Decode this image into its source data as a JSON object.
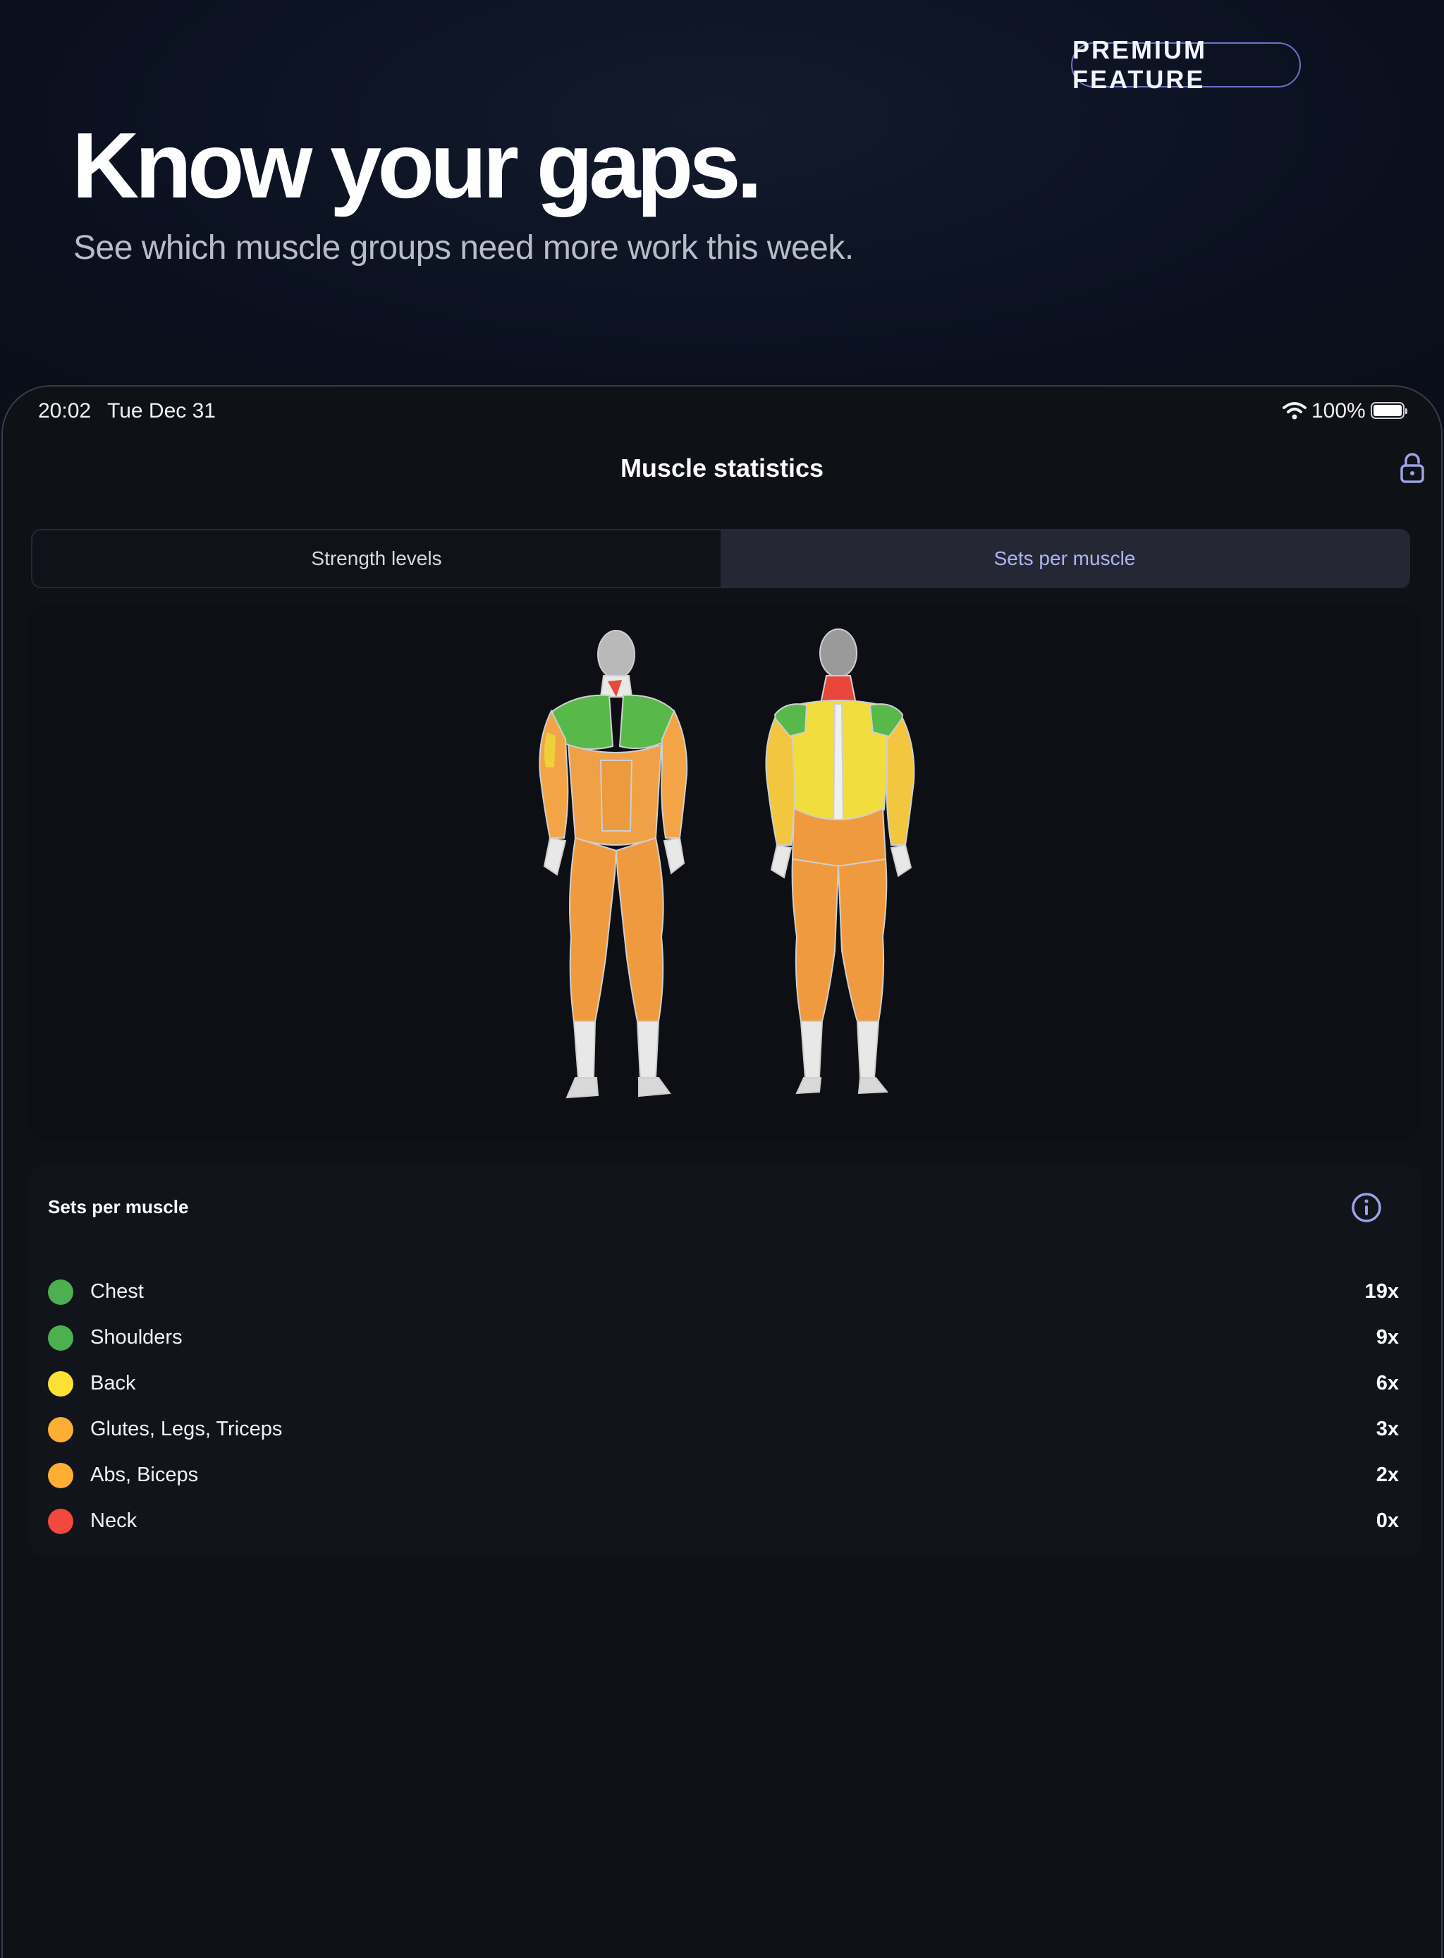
{
  "hero": {
    "badge": "PREMIUM FEATURE",
    "title": "Know your gaps.",
    "subtitle": "See which muscle groups need more work this week."
  },
  "status_bar": {
    "time": "20:02",
    "date": "Tue Dec 31",
    "battery": "100%",
    "icons": [
      "wifi-icon",
      "battery-icon"
    ]
  },
  "nav": {
    "title": "Muscle statistics",
    "right_icon": "lock-open-icon"
  },
  "tabs": [
    {
      "label": "Strength levels",
      "active": false
    },
    {
      "label": "Sets per muscle",
      "active": true
    }
  ],
  "body_map": {
    "views": [
      "front",
      "back"
    ],
    "icons": [
      "body-front-figure",
      "body-back-figure"
    ]
  },
  "stats": {
    "title": "Sets per muscle",
    "info_icon": "info-icon",
    "rows": [
      {
        "label": "Chest",
        "value": "19x",
        "color": "#4caf50"
      },
      {
        "label": "Shoulders",
        "value": "9x",
        "color": "#4caf50"
      },
      {
        "label": "Back",
        "value": "6x",
        "color": "#ffe135"
      },
      {
        "label": "Glutes, Legs, Triceps",
        "value": "3x",
        "color": "#ffae34"
      },
      {
        "label": "Abs, Biceps",
        "value": "2x",
        "color": "#ffae34"
      },
      {
        "label": "Neck",
        "value": "0x",
        "color": "#f2483d"
      }
    ]
  },
  "colors": {
    "background": "#0b0f1a",
    "device": "#0f1117",
    "accent": "#aeb4f2",
    "badge_border": "#6b73c9",
    "green": "#4caf50",
    "yellow": "#ffe135",
    "orange": "#ffae34",
    "red": "#f2483d"
  }
}
